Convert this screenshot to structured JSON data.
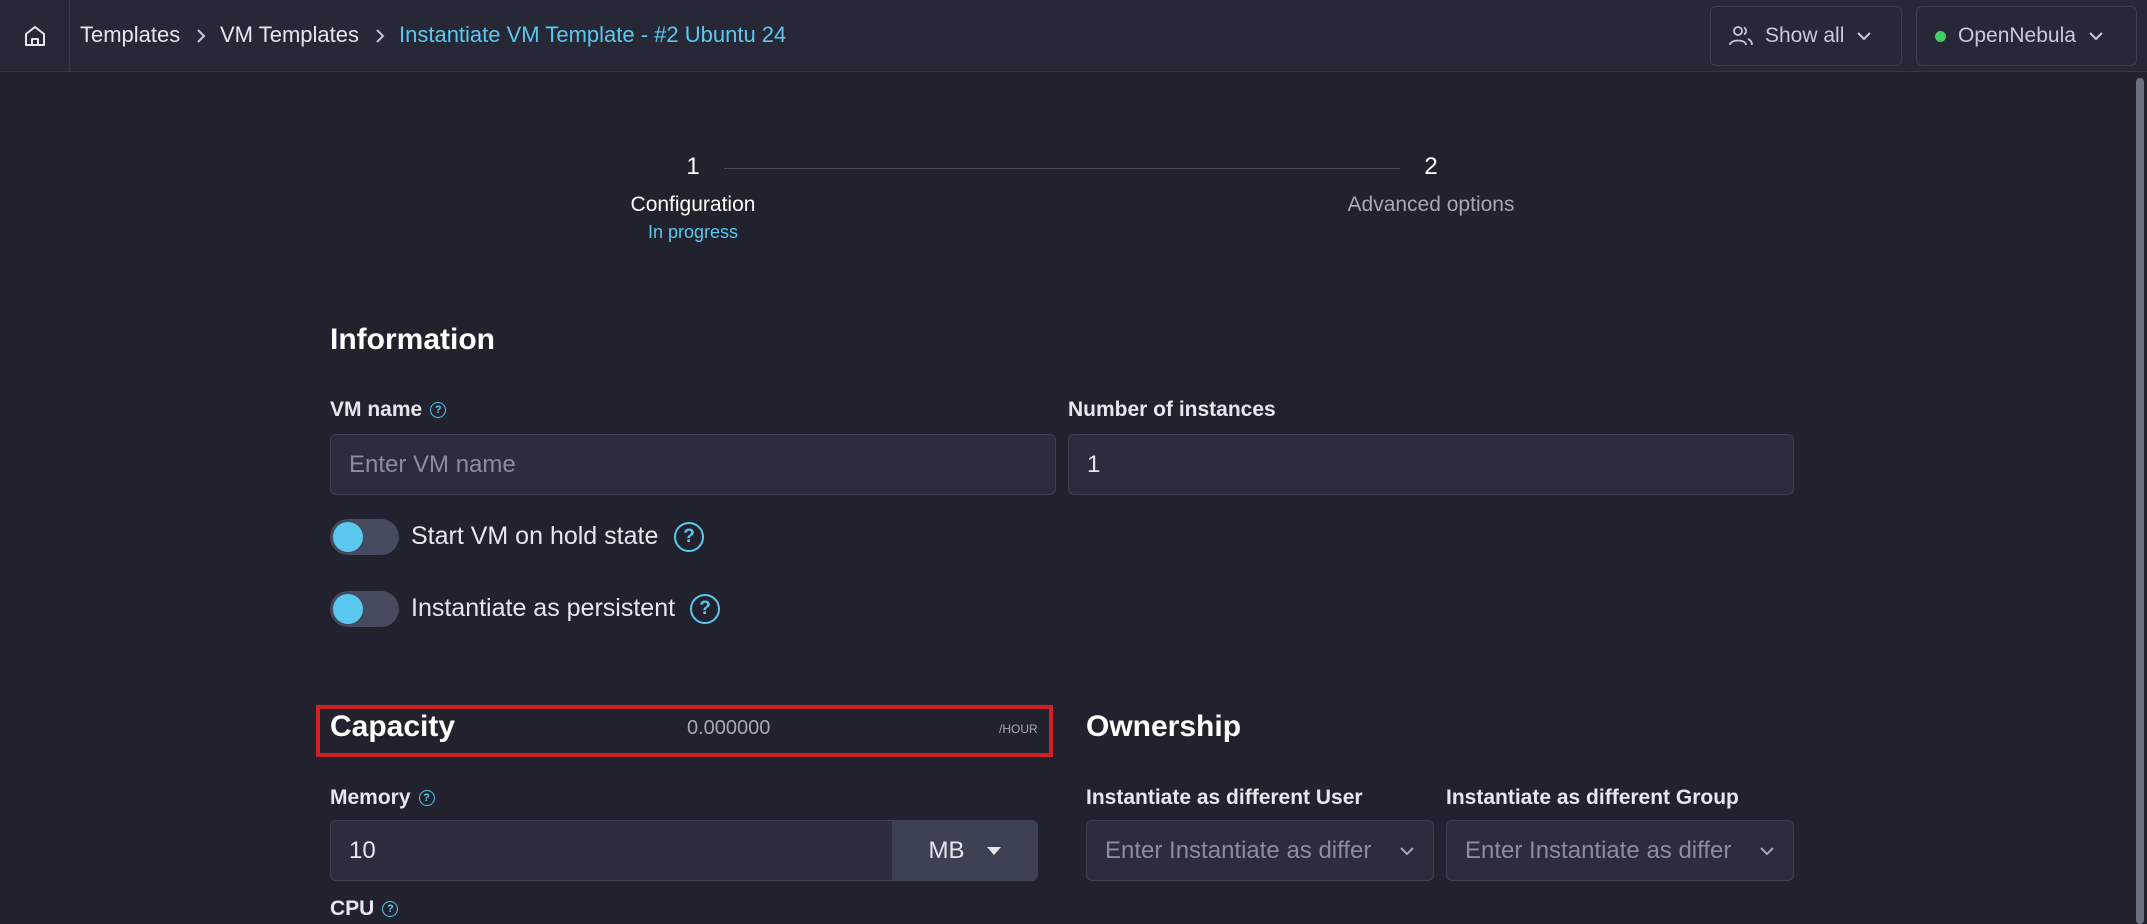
{
  "breadcrumb": {
    "items": [
      "Templates",
      "VM Templates"
    ],
    "current": "Instantiate VM Template - #2 Ubuntu 24"
  },
  "header": {
    "filter_label": "Show all",
    "zone_label": "OpenNebula",
    "zone_status_color": "#3ecb6a"
  },
  "stepper": {
    "steps": [
      {
        "number": "1",
        "label": "Configuration",
        "status": "In progress"
      },
      {
        "number": "2",
        "label": "Advanced options"
      }
    ]
  },
  "information": {
    "title": "Information",
    "vm_name": {
      "label": "VM name",
      "placeholder": "Enter VM name",
      "value": ""
    },
    "instances": {
      "label": "Number of instances",
      "value": "1"
    },
    "hold_toggle": {
      "label": "Start VM on hold state"
    },
    "persistent_toggle": {
      "label": "Instantiate as persistent"
    }
  },
  "capacity": {
    "title": "Capacity",
    "cost": "0.000000",
    "cost_unit": "/HOUR",
    "memory": {
      "label": "Memory",
      "value": "10",
      "unit": "MB"
    },
    "cpu": {
      "label": "CPU"
    }
  },
  "ownership": {
    "title": "Ownership",
    "user": {
      "label": "Instantiate as different User",
      "placeholder": "Enter Instantiate as differ"
    },
    "group": {
      "label": "Instantiate as different Group",
      "placeholder": "Enter Instantiate as differ"
    }
  },
  "colors": {
    "accent": "#5ac8ef",
    "background": "#21222e",
    "highlight_border": "#d01f25"
  }
}
